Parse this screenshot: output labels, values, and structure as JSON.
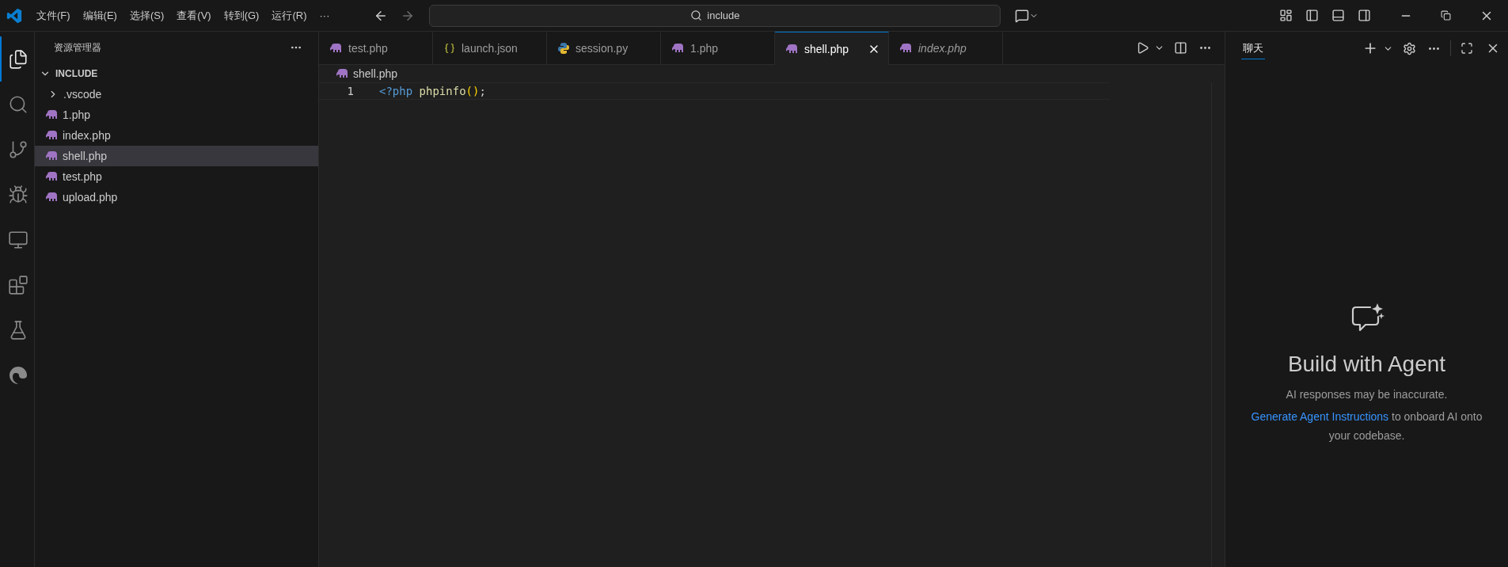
{
  "title_bar": {
    "menu": [
      "文件(F)",
      "编辑(E)",
      "选择(S)",
      "查看(V)",
      "转到(G)",
      "运行(R)"
    ],
    "more": "···",
    "search": {
      "value": "include"
    }
  },
  "activity_bar": [
    {
      "kind": "explorer",
      "selected": true
    },
    {
      "kind": "search",
      "selected": false
    },
    {
      "kind": "source-control",
      "selected": false
    },
    {
      "kind": "run-debug",
      "selected": false
    },
    {
      "kind": "remote",
      "selected": false
    },
    {
      "kind": "extensions",
      "selected": false
    },
    {
      "kind": "testing",
      "selected": false
    },
    {
      "kind": "edge",
      "selected": false
    }
  ],
  "sidebar": {
    "title": "资源管理器",
    "folder": {
      "label": "INCLUDE",
      "expanded": true,
      "children": [
        {
          "label": ".vscode",
          "kind": "folder",
          "expanded": false,
          "selected": false
        },
        {
          "label": "1.php",
          "kind": "php",
          "selected": false
        },
        {
          "label": "index.php",
          "kind": "php",
          "selected": false
        },
        {
          "label": "shell.php",
          "kind": "php",
          "selected": true
        },
        {
          "label": "test.php",
          "kind": "php",
          "selected": false
        },
        {
          "label": "upload.php",
          "kind": "php",
          "selected": false
        }
      ]
    }
  },
  "tabs": [
    {
      "label": "test.php",
      "kind": "php",
      "selected": false,
      "preview": false
    },
    {
      "label": "launch.json",
      "kind": "json",
      "selected": false,
      "preview": false
    },
    {
      "label": "session.py",
      "kind": "python",
      "selected": false,
      "preview": false
    },
    {
      "label": "1.php",
      "kind": "php",
      "selected": false,
      "preview": false
    },
    {
      "label": "shell.php",
      "kind": "php",
      "selected": true,
      "preview": false
    },
    {
      "label": "index.php",
      "kind": "php",
      "selected": false,
      "preview": true
    }
  ],
  "breadcrumb": {
    "label": "shell.php",
    "kind": "php"
  },
  "code": [
    {
      "number": "1",
      "tokens": [
        {
          "text": "<?php",
          "kind": "keyword"
        },
        {
          "text": " phpinfo",
          "kind": "function"
        },
        {
          "text": "()",
          "kind": "bracket"
        },
        {
          "text": ";",
          "kind": "plain"
        }
      ]
    }
  ],
  "chat": {
    "tab": {
      "label": "聊天",
      "selected": true
    },
    "title": "Build with Agent",
    "note": "AI responses may be inaccurate.",
    "link": "Generate Agent Instructions",
    "link_rest": "to onboard AI onto your codebase."
  }
}
